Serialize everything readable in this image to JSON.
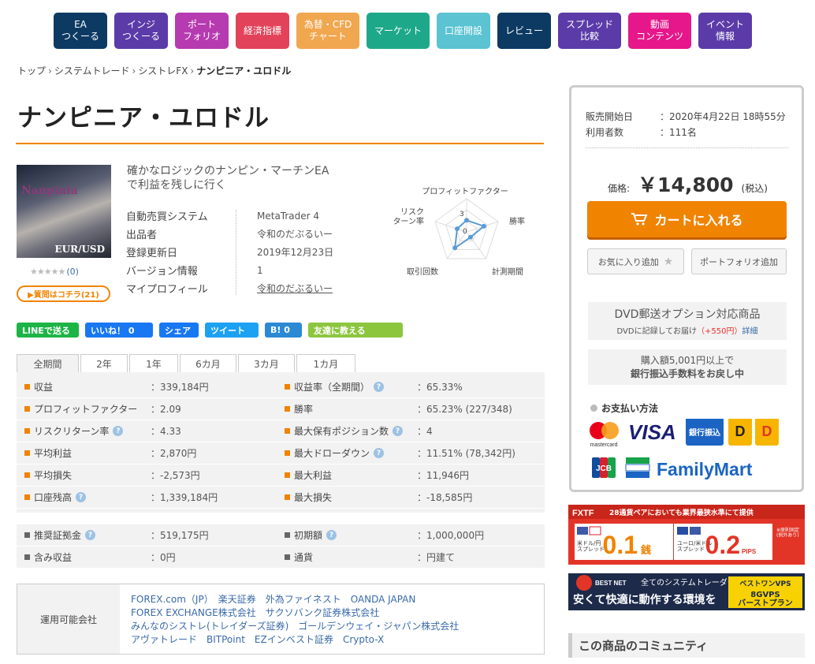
{
  "nav": [
    {
      "label": "EA\nつくーる",
      "color": "#0d3a63",
      "w": 68
    },
    {
      "label": "インジ\nつくーる",
      "color": "#5b3ba8",
      "w": 68
    },
    {
      "label": "ポート\nフォリオ",
      "color": "#b73bb0",
      "w": 68
    },
    {
      "label": "経済指標",
      "color": "#e2435a",
      "w": 68
    },
    {
      "label": "為替・CFD\nチャート",
      "color": "#f1a74f",
      "w": 80
    },
    {
      "label": "マーケット",
      "color": "#1ea88a",
      "w": 80
    },
    {
      "label": "口座開設",
      "color": "#5bc3d2",
      "w": 68
    },
    {
      "label": "レビュー",
      "color": "#0d3a63",
      "w": 68
    },
    {
      "label": "スプレッド\n比較",
      "color": "#5b3ba8",
      "w": 80
    },
    {
      "label": "動画\nコンテンツ",
      "color": "#e6178a",
      "w": 80
    },
    {
      "label": "イベント\n情報",
      "color": "#5b3ba8",
      "w": 68
    }
  ],
  "breadcrumb": {
    "items": [
      "トップ",
      "システムトレード",
      "シストレFX"
    ],
    "current": "ナンピニア・ユロドル"
  },
  "product": {
    "title": "ナンピニア・ユロドル",
    "thumb_text": "Nanpinia",
    "thumb_pair": "EUR/USD",
    "stars": "★★★★★",
    "review_count": "(0)",
    "question_button": "▶質問はコチラ(21)",
    "catch": "確かなロジックのナンピン・マーチンEA\nで利益を残しに行く",
    "specs": [
      {
        "k": "自動売買システム",
        "v": "MetaTrader 4"
      },
      {
        "k": "出品者",
        "v": "令和のだぶるいー"
      },
      {
        "k": "登録更新日",
        "v": "2019年12月23日"
      },
      {
        "k": "バージョン情報",
        "v": "1"
      },
      {
        "k": "マイプロフィール",
        "v": "令和のだぶるいー"
      }
    ]
  },
  "radar": {
    "labels": [
      "プロフィットファクター",
      "勝率",
      "計測期間",
      "取引回数",
      "リスク\nターン率"
    ],
    "scale_labels": [
      "3",
      "0"
    ],
    "values": [
      0.35,
      0.55,
      0.2,
      0.6,
      0.3
    ]
  },
  "share": [
    {
      "label": "LINEで送る",
      "color": "#1db446"
    },
    {
      "label": "いいね！ 0",
      "color": "#1877f2"
    },
    {
      "label": "シェア",
      "color": "#1877f2"
    },
    {
      "label": "ツイート",
      "color": "#1da1f2"
    },
    {
      "label": "B! 0",
      "color": "#2c8ad4"
    },
    {
      "label": "友達に教える",
      "color": "#8cc63f"
    }
  ],
  "tabs": [
    "全期間",
    "2年",
    "1年",
    "6カ月",
    "3カ月",
    "1カ月"
  ],
  "stats": [
    [
      {
        "k": "収益",
        "v": "：339,184円",
        "h": false
      },
      {
        "k": "収益率（全期間）",
        "v": "：65.33%",
        "h": true
      }
    ],
    [
      {
        "k": "プロフィットファクター",
        "v": "：2.09",
        "h": false
      },
      {
        "k": "勝率",
        "v": "：65.23% (227/348)",
        "h": false
      }
    ],
    [
      {
        "k": "リスクリターン率",
        "v": "：4.33",
        "h": true
      },
      {
        "k": "最大保有ポジション数",
        "v": "：4",
        "h": true
      }
    ],
    [
      {
        "k": "平均利益",
        "v": "：2,870円",
        "h": false
      },
      {
        "k": "最大ドローダウン",
        "v": "：11.51% (78,342円)",
        "h": true
      }
    ],
    [
      {
        "k": "平均損失",
        "v": "：-2,573円",
        "h": false
      },
      {
        "k": "最大利益",
        "v": "：11,946円",
        "h": false
      }
    ],
    [
      {
        "k": "口座残高",
        "v": "：1,339,184円",
        "h": true
      },
      {
        "k": "最大損失",
        "v": "：-18,585円",
        "h": false
      }
    ]
  ],
  "stats2": [
    [
      {
        "k": "推奨証拠金",
        "v": "：519,175円",
        "h": true
      },
      {
        "k": "初期額",
        "v": "：1,000,000円",
        "h": true
      }
    ],
    [
      {
        "k": "含み収益",
        "v": "：0円",
        "h": false
      },
      {
        "k": "通貨",
        "v": "：円建て",
        "h": false
      }
    ]
  ],
  "brokers": {
    "label": "運用可能会社",
    "lines": [
      "FOREX.com（JP）　楽天証券　外為ファイネスト　OANDA JAPAN",
      "FOREX EXCHANGE株式会社　サクソバンク証券株式会社",
      "みんなのシストレ(トレイダーズ証券)　ゴールデンウェイ・ジャパン株式会社",
      "アヴァトレード　BITPoint　EZインベスト証券　Crypto-X"
    ]
  },
  "side": {
    "release_k": "販売開始日",
    "release_v": "：2020年4月22日 18時55分",
    "users_k": "利用者数",
    "users_v": "：111名",
    "price_label": "価格:",
    "price": "￥14,800",
    "tax": "(税込)",
    "cart": "カートに入れる",
    "fav": "お気に入り追加",
    "portfolio": "ポートフォリオ追加",
    "dvd_title": "DVD郵送オプション対応商品",
    "dvd_note": "DVDに記録してお届け",
    "dvd_price": "（+550円）",
    "dvd_link": "詳細",
    "bank1": "購入額5,001円以上で",
    "bank2": "銀行振込手数料をお戻し中",
    "pay_title": "お支払い方法",
    "logos": {
      "mc": "mastercard",
      "visa": "VISA",
      "bank": "銀行振込",
      "jcb": "JCB",
      "fm": "FamilyMart"
    }
  },
  "ad1": {
    "brand": "FXTF",
    "headline": "28通貨ペアにおいても業界最狭水準にて提供",
    "left_label": "米ドル/円\nスプレッド",
    "left_val": "0.1",
    "left_unit": "銭",
    "right_label": "ユーロ/米ドル\nスプレッド",
    "right_val": "0.2",
    "right_unit": "PIPS",
    "note": "※原則固定\n(例外あり)"
  },
  "ad2": {
    "brand": "BEST NET",
    "top": "全てのシステムトレーダーに",
    "bottom": "安くて快適に動作する環境を",
    "badge1": "ベストワンVPS",
    "badge2": "8GVPS\nバーストプラン"
  },
  "community": "この商品のコミュニティ"
}
